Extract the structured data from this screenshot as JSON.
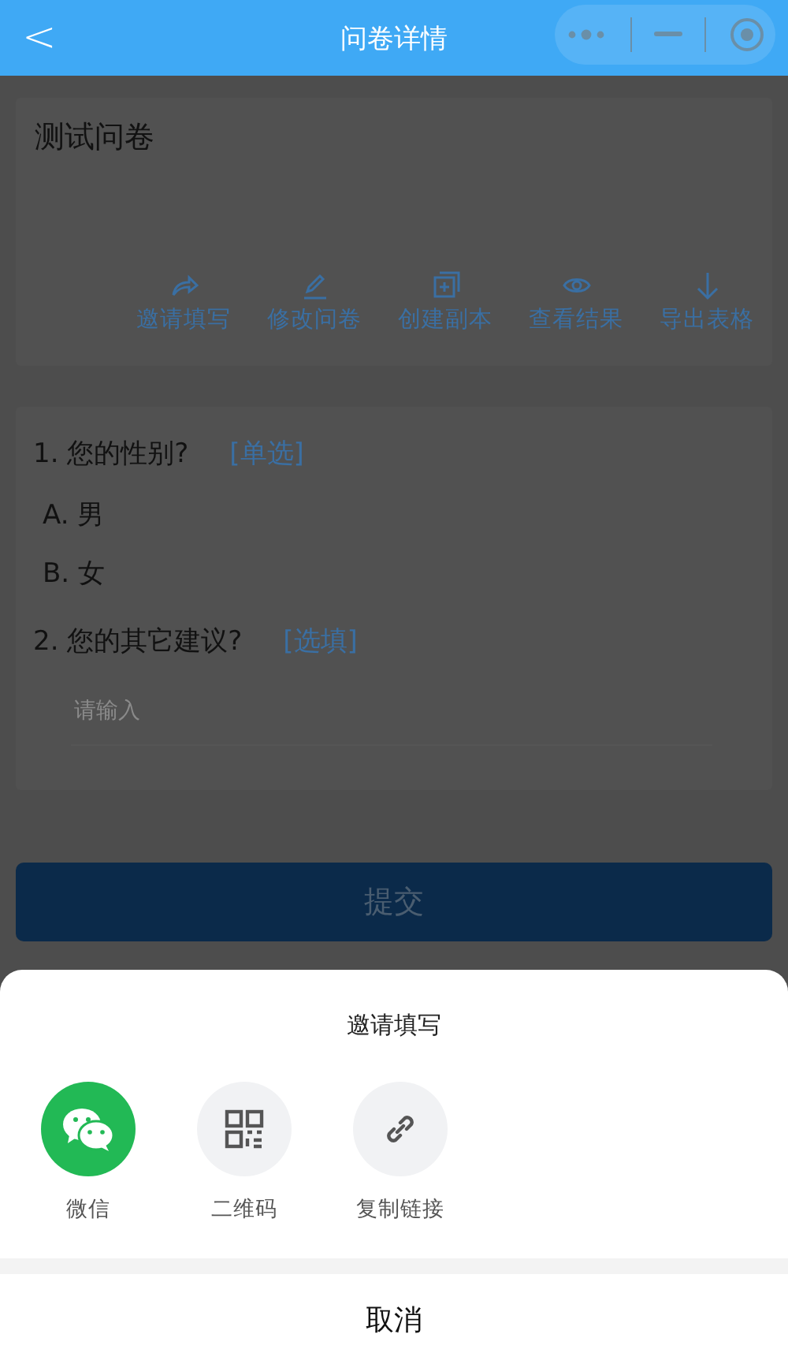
{
  "nav_bar": {
    "back": "<",
    "title": "问卷详情"
  },
  "survey": {
    "title": "测试问卷",
    "actions": [
      {
        "kind": "share",
        "label": "邀请填写"
      },
      {
        "kind": "edit",
        "label": "修改问卷"
      },
      {
        "kind": "copy",
        "label": "创建副本"
      },
      {
        "kind": "view",
        "label": "查看结果"
      },
      {
        "kind": "export",
        "label": "导出表格"
      }
    ]
  },
  "questions": [
    {
      "kind": "choice",
      "title": "1. 您的性别?",
      "tag": "[单选]",
      "options": [
        "A. 男",
        "B. 女"
      ]
    },
    {
      "kind": "text",
      "title": "2. 您的其它建议?",
      "tag": "[选填]",
      "placeholder": "请输入"
    }
  ],
  "submit_button": "提交",
  "share_sheet": {
    "title": "邀请填写",
    "items": [
      {
        "kind": "wechat",
        "label": "微信"
      },
      {
        "kind": "qrcode",
        "label": "二维码"
      },
      {
        "kind": "link",
        "label": "复制链接"
      }
    ],
    "cancel": "取消"
  }
}
